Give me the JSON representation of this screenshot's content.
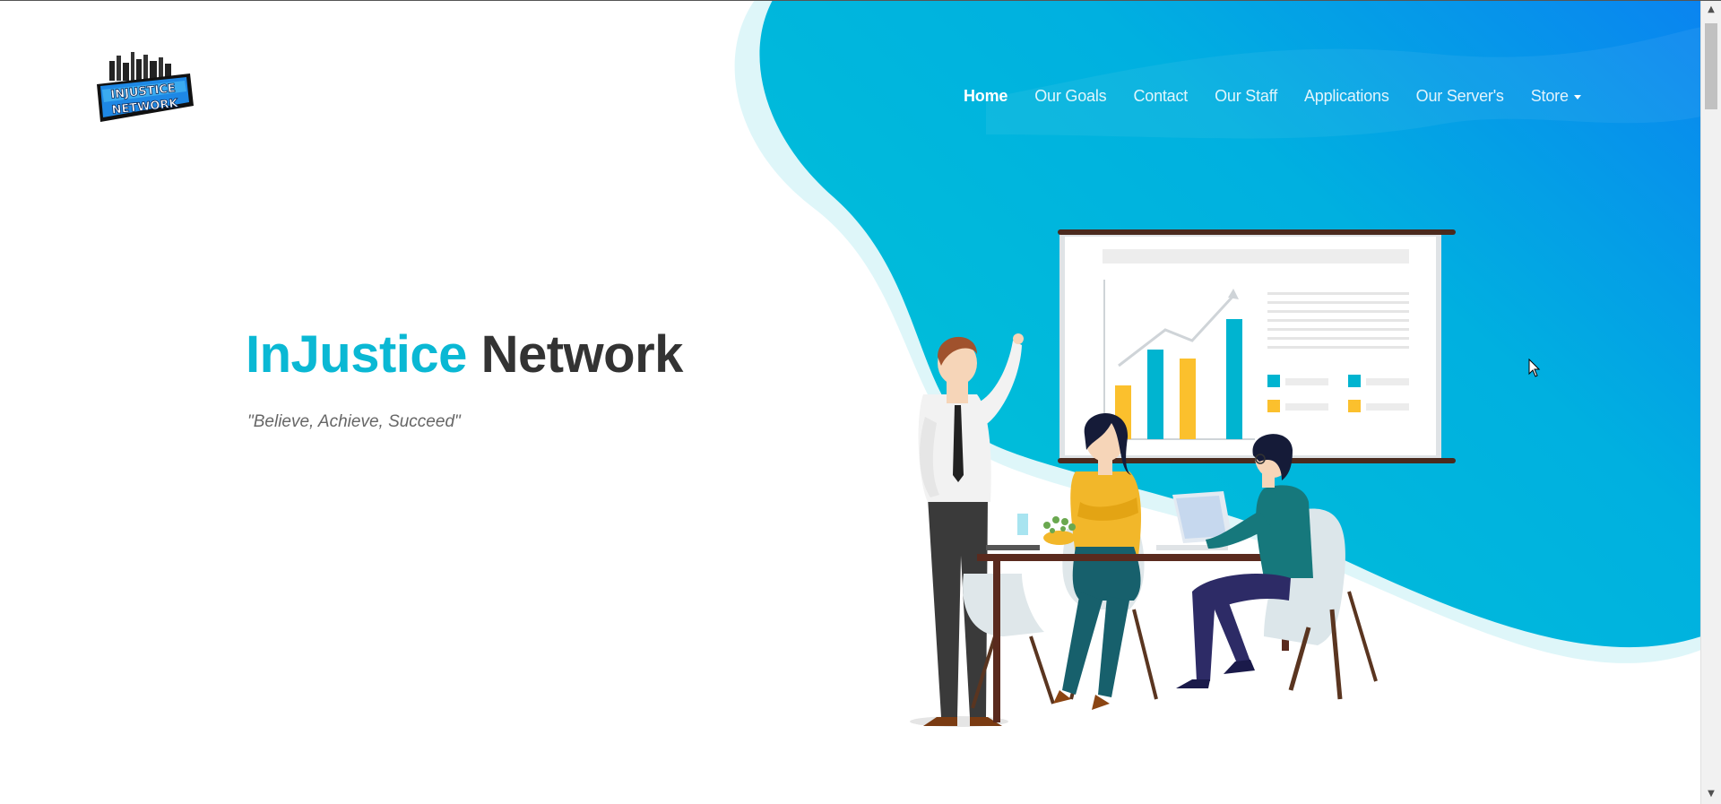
{
  "logo": {
    "line1": "INJUSTICE",
    "line2": "NETWORK"
  },
  "nav": {
    "items": [
      {
        "label": "Home",
        "active": true
      },
      {
        "label": "Our Goals",
        "active": false
      },
      {
        "label": "Contact",
        "active": false
      },
      {
        "label": "Our Staff",
        "active": false
      },
      {
        "label": "Applications",
        "active": false
      },
      {
        "label": "Our Server's",
        "active": false
      }
    ],
    "store_label": "Store"
  },
  "hero": {
    "title_accent": "InJustice",
    "title_rest": "Network",
    "tagline": "\"Believe, Achieve, Succeed\""
  },
  "colors": {
    "accent": "#0ab8d4",
    "blob_start": "#00c0d8",
    "blob_end": "#0a84f0",
    "title_dark": "#333333"
  },
  "icons": {
    "scroll_up": "scroll-up-arrow-icon",
    "scroll_down": "scroll-down-arrow-icon",
    "store_caret": "caret-down-icon",
    "cursor": "mouse-pointer-icon"
  }
}
